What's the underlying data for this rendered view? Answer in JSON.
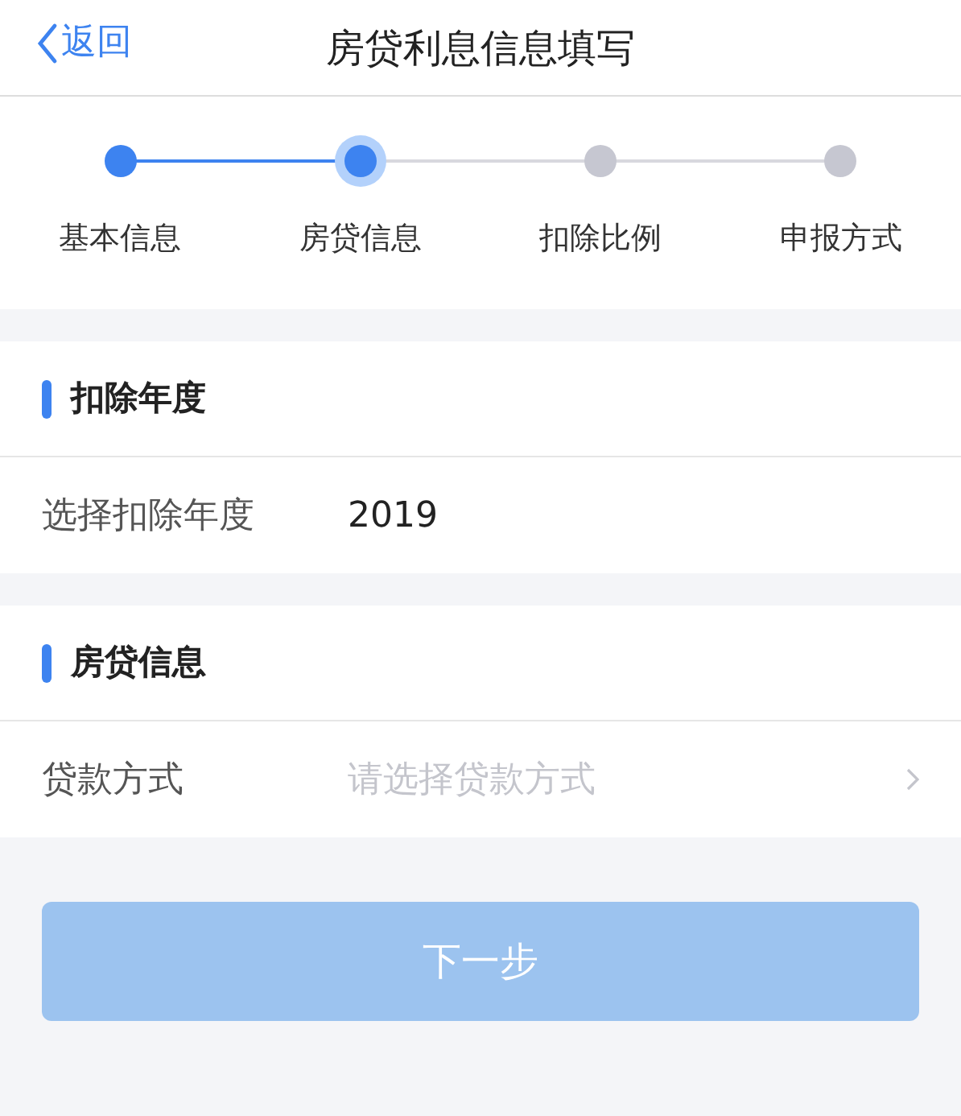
{
  "nav": {
    "back": "返回",
    "title": "房贷利息信息填写"
  },
  "steps": [
    {
      "label": "基本信息",
      "kind": "done"
    },
    {
      "label": "房贷信息",
      "kind": "current"
    },
    {
      "label": "扣除比例",
      "kind": "todo"
    },
    {
      "label": "申报方式",
      "kind": "todo"
    }
  ],
  "sections": [
    {
      "title": "扣除年度",
      "fields": [
        {
          "label": "选择扣除年度",
          "value": "2019",
          "chevron": false
        }
      ]
    },
    {
      "title": "房贷信息",
      "fields": [
        {
          "label": "贷款方式",
          "placeholder": "请选择贷款方式",
          "chevron": true
        }
      ]
    }
  ],
  "next_button": {
    "label": "下一步",
    "disabled": true
  }
}
